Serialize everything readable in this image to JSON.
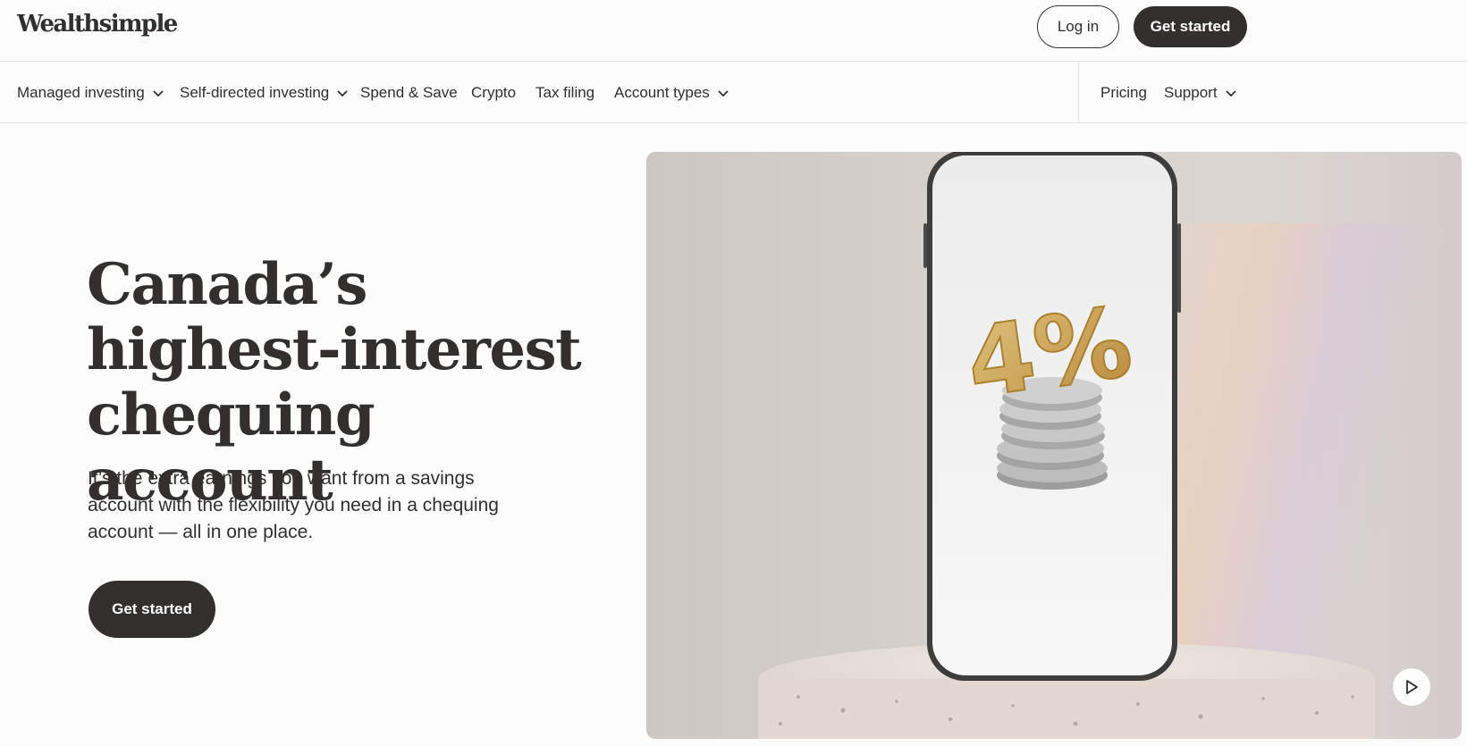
{
  "brand": {
    "name": "Wealthsimple"
  },
  "header": {
    "login_label": "Log in",
    "get_started_label": "Get started"
  },
  "nav": {
    "left": [
      {
        "label": "Managed investing",
        "dropdown": true
      },
      {
        "label": "Self-directed investing",
        "dropdown": true
      },
      {
        "label": "Spend & Save",
        "dropdown": false
      },
      {
        "label": "Crypto",
        "dropdown": false
      },
      {
        "label": "Tax filing",
        "dropdown": false
      },
      {
        "label": "Account types",
        "dropdown": true
      }
    ],
    "right": [
      {
        "label": "Pricing",
        "dropdown": false
      },
      {
        "label": "Support",
        "dropdown": true
      }
    ]
  },
  "hero": {
    "title_lines": [
      "Canada’s",
      "highest-interest",
      "chequing account"
    ],
    "subtitle": "It’s the extra earnings you want from a savings account with the flexibility you need in a chequing account — all in one place.",
    "cta_label": "Get started",
    "media": {
      "rate_text": "4%",
      "play_icon": "play-icon"
    }
  },
  "colors": {
    "ink": "#32302f",
    "background": "#fcfcfc",
    "gold": "#c9a04f"
  }
}
